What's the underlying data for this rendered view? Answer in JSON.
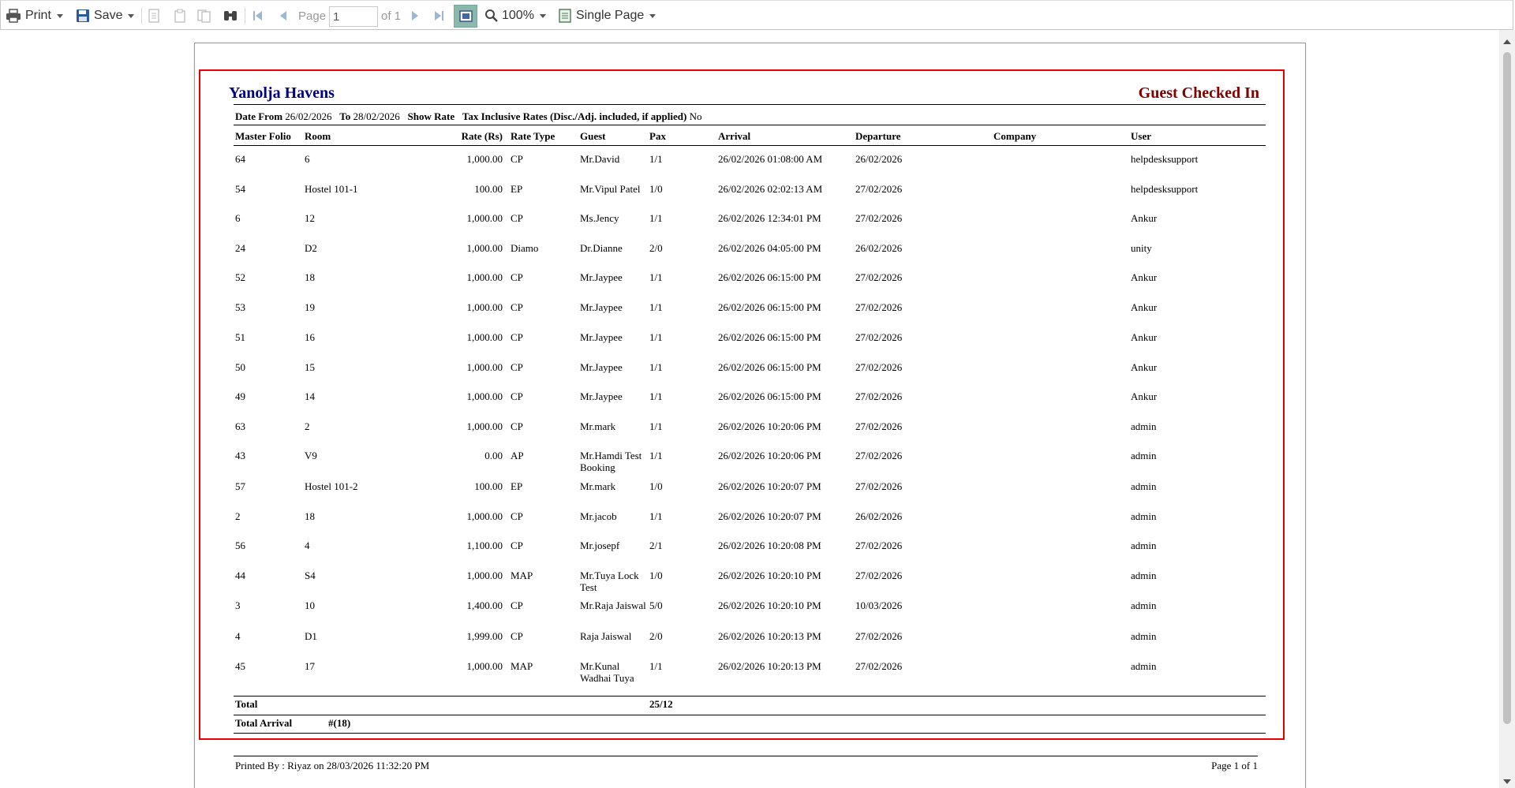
{
  "toolbar": {
    "print_label": "Print",
    "save_label": "Save",
    "page_label": "Page",
    "page_value": "1",
    "of_label": "of 1",
    "zoom_label": "100%",
    "view_mode_label": "Single Page"
  },
  "report": {
    "hotel_name": "Yanolja Havens",
    "title": "Guest Checked In",
    "filter": {
      "date_from_label": "Date From",
      "date_from": "26/02/2026",
      "to_label": "To",
      "to": "28/02/2026",
      "show_rate_label": "Show Rate",
      "tax_label": "Tax Inclusive Rates (Disc./Adj. included, if applied)",
      "tax_value": "No"
    },
    "columns": [
      "Master Folio",
      "Room",
      "Rate (Rs)",
      "Rate Type",
      "Guest",
      "Pax",
      "Arrival",
      "Departure",
      "Company",
      "User"
    ],
    "rows": [
      [
        "64",
        "6",
        "1,000.00",
        "CP",
        "Mr.David",
        "1/1",
        "26/02/2026 01:08:00 AM",
        "26/02/2026",
        "",
        "helpdesksupport"
      ],
      [
        "54",
        "Hostel 101-1",
        "100.00",
        "EP",
        "Mr.Vipul Patel",
        "1/0",
        "26/02/2026 02:02:13 AM",
        "27/02/2026",
        "",
        "helpdesksupport"
      ],
      [
        "6",
        "12",
        "1,000.00",
        "CP",
        "Ms.Jency",
        "1/1",
        "26/02/2026 12:34:01 PM",
        "27/02/2026",
        "",
        "Ankur"
      ],
      [
        "24",
        "D2",
        "1,000.00",
        "Diamo",
        "Dr.Dianne",
        "2/0",
        "26/02/2026 04:05:00 PM",
        "26/02/2026",
        "",
        "unity"
      ],
      [
        "52",
        "18",
        "1,000.00",
        "CP",
        "Mr.Jaypee",
        "1/1",
        "26/02/2026 06:15:00 PM",
        "27/02/2026",
        "",
        "Ankur"
      ],
      [
        "53",
        "19",
        "1,000.00",
        "CP",
        "Mr.Jaypee",
        "1/1",
        "26/02/2026 06:15:00 PM",
        "27/02/2026",
        "",
        "Ankur"
      ],
      [
        "51",
        "16",
        "1,000.00",
        "CP",
        "Mr.Jaypee",
        "1/1",
        "26/02/2026 06:15:00 PM",
        "27/02/2026",
        "",
        "Ankur"
      ],
      [
        "50",
        "15",
        "1,000.00",
        "CP",
        "Mr.Jaypee",
        "1/1",
        "26/02/2026 06:15:00 PM",
        "27/02/2026",
        "",
        "Ankur"
      ],
      [
        "49",
        "14",
        "1,000.00",
        "CP",
        "Mr.Jaypee",
        "1/1",
        "26/02/2026 06:15:00 PM",
        "27/02/2026",
        "",
        "Ankur"
      ],
      [
        "63",
        "2",
        "1,000.00",
        "CP",
        "Mr.mark",
        "1/1",
        "26/02/2026 10:20:06 PM",
        "27/02/2026",
        "",
        "admin"
      ],
      [
        "43",
        "V9",
        "0.00",
        "AP",
        "Mr.Hamdi Test Booking",
        "1/1",
        "26/02/2026 10:20:06 PM",
        "27/02/2026",
        "",
        "admin"
      ],
      [
        "57",
        "Hostel 101-2",
        "100.00",
        "EP",
        "Mr.mark",
        "1/0",
        "26/02/2026 10:20:07 PM",
        "27/02/2026",
        "",
        "admin"
      ],
      [
        "2",
        "18",
        "1,000.00",
        "CP",
        "Mr.jacob",
        "1/1",
        "26/02/2026 10:20:07 PM",
        "26/02/2026",
        "",
        "admin"
      ],
      [
        "56",
        "4",
        "1,100.00",
        "CP",
        "Mr.josepf",
        "2/1",
        "26/02/2026 10:20:08 PM",
        "27/02/2026",
        "",
        "admin"
      ],
      [
        "44",
        "S4",
        "1,000.00",
        "MAP",
        "Mr.Tuya Lock Test",
        "1/0",
        "26/02/2026 10:20:10 PM",
        "27/02/2026",
        "",
        "admin"
      ],
      [
        "3",
        "10",
        "1,400.00",
        "CP",
        "Mr.Raja Jaiswal",
        "5/0",
        "26/02/2026 10:20:10 PM",
        "10/03/2026",
        "",
        "admin"
      ],
      [
        "4",
        "D1",
        "1,999.00",
        "CP",
        "Raja Jaiswal",
        "2/0",
        "26/02/2026 10:20:13 PM",
        "27/02/2026",
        "",
        "admin"
      ],
      [
        "45",
        "17",
        "1,000.00",
        "MAP",
        "Mr.Kunal Wadhai Tuya",
        "1/1",
        "26/02/2026 10:20:13 PM",
        "27/02/2026",
        "",
        "admin"
      ]
    ],
    "total_label": "Total",
    "total_pax": "25/12",
    "total_arrival_label": "Total Arrival",
    "total_arrival_value": "#(18)",
    "printed_by": "Printed By : Riyaz on 28/03/2026 11:32:20 PM",
    "page_info": "Page 1 of 1"
  }
}
